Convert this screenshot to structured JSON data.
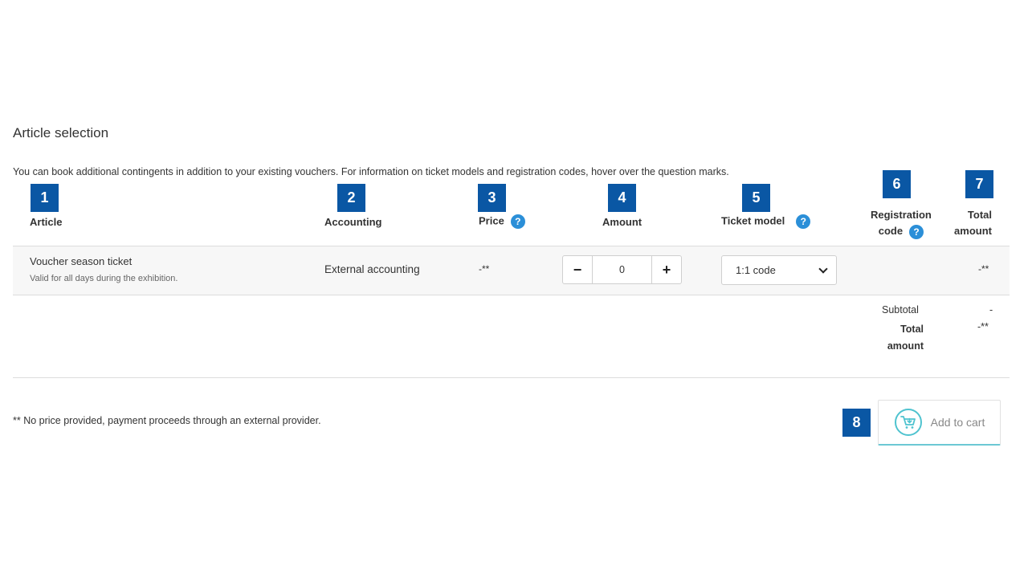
{
  "section_title": "Article selection",
  "intro": "You can book additional contingents in addition to your existing vouchers. For information on ticket models and registration codes, hover over the question marks.",
  "badges": [
    "1",
    "2",
    "3",
    "4",
    "5",
    "6",
    "7",
    "8"
  ],
  "help_glyph": "?",
  "headers": {
    "article": "Article",
    "accounting": "Accounting",
    "price": "Price",
    "amount": "Amount",
    "ticket_model": "Ticket model",
    "registration_line1": "Registration",
    "registration_line2": "code",
    "total_line1": "Total",
    "total_line2": "amount"
  },
  "row": {
    "name": "Voucher season ticket",
    "description": "Valid for all days during the exhibition.",
    "accounting": "External accounting",
    "price": "-**",
    "amount": "0",
    "minus": "−",
    "plus": "+",
    "ticket_model": "1:1 code",
    "total": "-**"
  },
  "summary": {
    "subtotal_label": "Subtotal",
    "subtotal_value": "-",
    "total_label_line1": "Total",
    "total_label_line2": "amount",
    "total_value": "-**"
  },
  "footnote": "** No price provided, payment proceeds through an external provider.",
  "cart_button": "Add to cart",
  "colors": {
    "badge": "#0a57a4",
    "help": "#2b8fd8",
    "cart_accent": "#6cc8d4"
  }
}
